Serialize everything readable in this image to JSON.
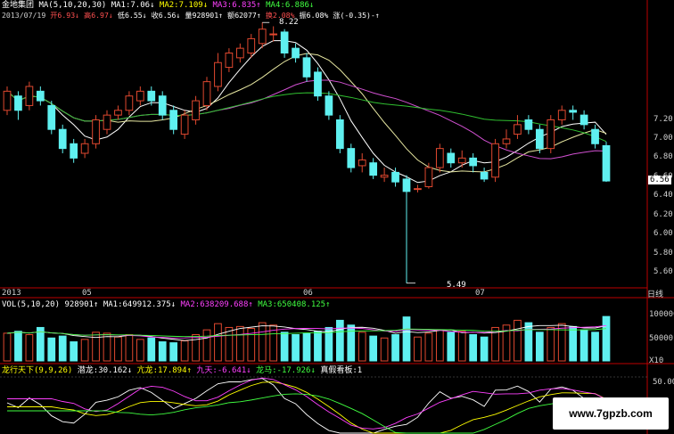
{
  "header": {
    "stock_name": "金地集团",
    "ma_label": "MA(5,10,20,30)",
    "ma1": "MA1:7.06↓",
    "ma2": "MA2:7.109↓",
    "ma3": "MA3:6.835↑",
    "ma4": "MA4:6.886↓",
    "date": "2013/07/19",
    "open": "开6.93↓",
    "high": "高6.97↓",
    "low": "低6.55↓",
    "close": "收6.56↓",
    "volume": "量928901↑",
    "amount": "额62077↑",
    "turnover": "换2.08%",
    "amplitude": "振6.08%",
    "change": "涨(-0.35)-↑"
  },
  "vol_header": {
    "label": "VOL(5,10,20)",
    "value": "928901↑",
    "ma1": "MA1:649912.375↓",
    "ma2": "MA2:638209.688↑",
    "ma3": "MA3:650408.125↑"
  },
  "ind_header": {
    "label": "龙行天下(9,9,26)",
    "qianlong": "潜龙:30.162↓",
    "kanglong": "亢龙:17.894↑",
    "jiutian": "九天:-6.641↓",
    "longma": "龙马:-17.926↓",
    "zhenjie": "真假看板:1"
  },
  "price_axis": [
    "7.20",
    "7.00",
    "6.80",
    "6.60",
    "6.40",
    "6.20",
    "6.00",
    "5.80",
    "5.60"
  ],
  "current_price": "6.56",
  "vol_axis": [
    "100000",
    "50000"
  ],
  "vol_unit": "X10",
  "ind_axis": [
    "50.00"
  ],
  "time_labels": [
    "2013",
    "05",
    "06",
    "07"
  ],
  "period": "日线",
  "high_mark": "8.22",
  "low_mark": "5.49",
  "watermark": "www.7gpzb.com",
  "colors": {
    "up": "#e0482f",
    "down": "#5ff0f0",
    "ma5": "#ffffff",
    "ma10": "#e6e6a0",
    "ma20": "#d050d0",
    "ma30": "#30c030",
    "yellow": "#ffff00",
    "magenta": "#ff40ff",
    "green": "#40ff40"
  },
  "chart_data": {
    "type": "candlestick",
    "candles": [
      {
        "o": 7.3,
        "c": 7.5,
        "h": 7.55,
        "l": 7.25
      },
      {
        "o": 7.45,
        "c": 7.3,
        "h": 7.5,
        "l": 7.2
      },
      {
        "o": 7.35,
        "c": 7.55,
        "h": 7.6,
        "l": 7.3
      },
      {
        "o": 7.5,
        "c": 7.4,
        "h": 7.55,
        "l": 7.35
      },
      {
        "o": 7.35,
        "c": 7.1,
        "h": 7.4,
        "l": 7.05
      },
      {
        "o": 7.1,
        "c": 6.9,
        "h": 7.15,
        "l": 6.85
      },
      {
        "o": 6.95,
        "c": 6.8,
        "h": 7.0,
        "l": 6.75
      },
      {
        "o": 6.85,
        "c": 6.95,
        "h": 7.0,
        "l": 6.8
      },
      {
        "o": 6.95,
        "c": 7.2,
        "h": 7.25,
        "l": 6.9
      },
      {
        "o": 7.1,
        "c": 7.25,
        "h": 7.3,
        "l": 7.05
      },
      {
        "o": 7.25,
        "c": 7.3,
        "h": 7.35,
        "l": 7.2
      },
      {
        "o": 7.3,
        "c": 7.45,
        "h": 7.5,
        "l": 7.25
      },
      {
        "o": 7.4,
        "c": 7.5,
        "h": 7.55,
        "l": 7.35
      },
      {
        "o": 7.5,
        "c": 7.4,
        "h": 7.55,
        "l": 7.35
      },
      {
        "o": 7.45,
        "c": 7.25,
        "h": 7.5,
        "l": 7.2
      },
      {
        "o": 7.3,
        "c": 7.1,
        "h": 7.35,
        "l": 7.05
      },
      {
        "o": 7.05,
        "c": 7.25,
        "h": 7.3,
        "l": 7.0
      },
      {
        "o": 7.2,
        "c": 7.4,
        "h": 7.45,
        "l": 7.15
      },
      {
        "o": 7.35,
        "c": 7.6,
        "h": 7.65,
        "l": 7.3
      },
      {
        "o": 7.55,
        "c": 7.8,
        "h": 7.9,
        "l": 7.5
      },
      {
        "o": 7.75,
        "c": 7.9,
        "h": 7.95,
        "l": 7.7
      },
      {
        "o": 7.85,
        "c": 7.95,
        "h": 8.0,
        "l": 7.8
      },
      {
        "o": 7.9,
        "c": 8.05,
        "h": 8.1,
        "l": 7.85
      },
      {
        "o": 8.0,
        "c": 8.15,
        "h": 8.22,
        "l": 7.95
      },
      {
        "o": 8.1,
        "c": 8.1,
        "h": 8.18,
        "l": 8.02
      },
      {
        "o": 8.12,
        "c": 7.9,
        "h": 8.15,
        "l": 7.85
      },
      {
        "o": 7.95,
        "c": 7.85,
        "h": 8.0,
        "l": 7.8
      },
      {
        "o": 7.85,
        "c": 7.65,
        "h": 7.9,
        "l": 7.6
      },
      {
        "o": 7.7,
        "c": 7.45,
        "h": 7.75,
        "l": 7.4
      },
      {
        "o": 7.45,
        "c": 7.25,
        "h": 7.5,
        "l": 7.2
      },
      {
        "o": 7.2,
        "c": 6.9,
        "h": 7.25,
        "l": 6.85
      },
      {
        "o": 6.9,
        "c": 6.7,
        "h": 6.95,
        "l": 6.65
      },
      {
        "o": 6.72,
        "c": 6.78,
        "h": 6.85,
        "l": 6.65
      },
      {
        "o": 6.75,
        "c": 6.62,
        "h": 6.8,
        "l": 6.58
      },
      {
        "o": 6.6,
        "c": 6.62,
        "h": 6.7,
        "l": 6.55
      },
      {
        "o": 6.65,
        "c": 6.55,
        "h": 6.7,
        "l": 6.5
      },
      {
        "o": 6.58,
        "c": 6.45,
        "h": 6.62,
        "l": 5.49
      },
      {
        "o": 6.48,
        "c": 6.48,
        "h": 6.52,
        "l": 6.44
      },
      {
        "o": 6.5,
        "c": 6.7,
        "h": 6.75,
        "l": 6.48
      },
      {
        "o": 6.7,
        "c": 6.9,
        "h": 6.95,
        "l": 6.65
      },
      {
        "o": 6.85,
        "c": 6.75,
        "h": 6.9,
        "l": 6.7
      },
      {
        "o": 6.75,
        "c": 6.8,
        "h": 6.88,
        "l": 6.7
      },
      {
        "o": 6.8,
        "c": 6.72,
        "h": 6.85,
        "l": 6.65
      },
      {
        "o": 6.65,
        "c": 6.58,
        "h": 6.7,
        "l": 6.55
      },
      {
        "o": 6.6,
        "c": 6.95,
        "h": 7.0,
        "l": 6.55
      },
      {
        "o": 6.95,
        "c": 7.0,
        "h": 7.1,
        "l": 6.9
      },
      {
        "o": 7.05,
        "c": 7.15,
        "h": 7.25,
        "l": 7.0
      },
      {
        "o": 7.2,
        "c": 7.1,
        "h": 7.25,
        "l": 7.05
      },
      {
        "o": 7.1,
        "c": 6.9,
        "h": 7.15,
        "l": 6.85
      },
      {
        "o": 6.9,
        "c": 7.2,
        "h": 7.25,
        "l": 6.85
      },
      {
        "o": 7.2,
        "c": 7.3,
        "h": 7.35,
        "l": 7.15
      },
      {
        "o": 7.3,
        "c": 7.28,
        "h": 7.35,
        "l": 7.2
      },
      {
        "o": 7.25,
        "c": 7.15,
        "h": 7.3,
        "l": 7.1
      },
      {
        "o": 7.1,
        "c": 6.95,
        "h": 7.15,
        "l": 6.9
      },
      {
        "o": 6.93,
        "c": 6.56,
        "h": 6.97,
        "l": 6.55
      }
    ],
    "volumes": [
      58,
      62,
      55,
      70,
      48,
      52,
      40,
      45,
      60,
      58,
      50,
      55,
      45,
      48,
      40,
      38,
      42,
      55,
      65,
      78,
      70,
      72,
      68,
      80,
      75,
      60,
      55,
      58,
      62,
      70,
      85,
      75,
      60,
      52,
      48,
      55,
      92,
      50,
      58,
      65,
      60,
      62,
      55,
      50,
      70,
      75,
      85,
      80,
      60,
      70,
      78,
      72,
      65,
      60,
      93
    ],
    "ylim": [
      5.45,
      8.25
    ],
    "vol_ylim": [
      0,
      110
    ]
  }
}
